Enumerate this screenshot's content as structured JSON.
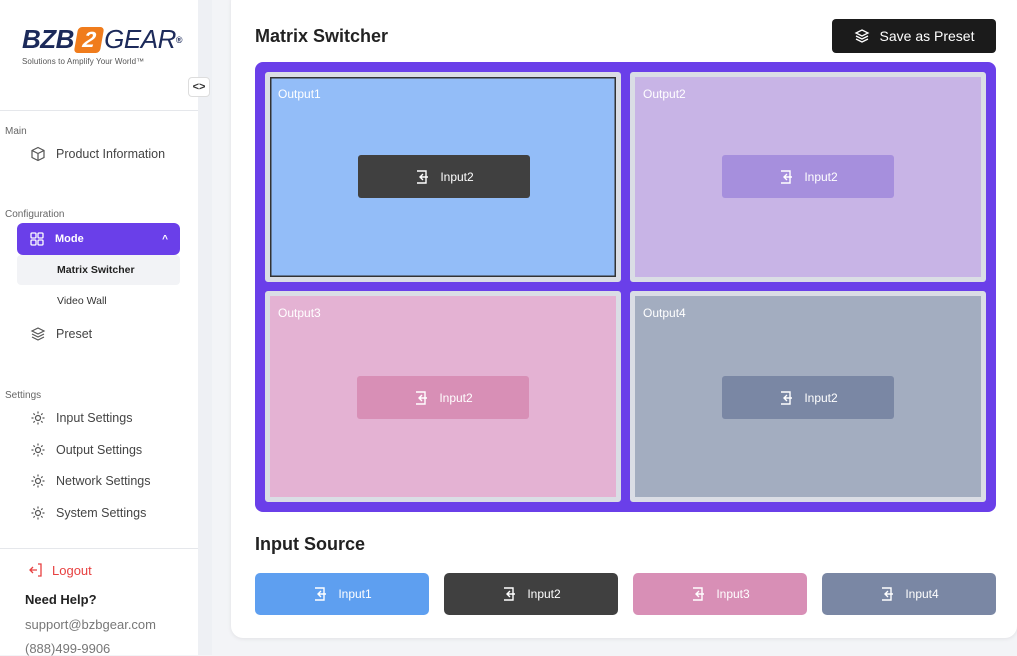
{
  "brand": {
    "bzb": "BZB",
    "two": "2",
    "gear": "GEAR",
    "reg": "®",
    "tagline": "Solutions to Amplify Your World™"
  },
  "sidebar": {
    "toggle_label": "<>",
    "main_section": "Main",
    "product_info": "Product Information",
    "config_section": "Configuration",
    "mode_label": "Mode",
    "mode_chevron": "^",
    "sub_matrix": "Matrix Switcher",
    "sub_videowall": "Video Wall",
    "preset_label": "Preset",
    "settings_section": "Settings",
    "settings_items": [
      "Input Settings",
      "Output Settings",
      "Network Settings",
      "System Settings"
    ],
    "logout": "Logout",
    "help_title": "Need Help?",
    "support_email": "support@bzbgear.com",
    "phone": "(888)499-9906"
  },
  "header": {
    "title": "Matrix Switcher",
    "preset_button": "Save as Preset"
  },
  "matrix": {
    "outputs": [
      {
        "label": "Output1",
        "input": "Input2",
        "tile_color": "#93bdf8",
        "button_color": "#404040",
        "selected": true
      },
      {
        "label": "Output2",
        "input": "Input2",
        "tile_color": "#c8b4e6",
        "button_color": "#a68fdd",
        "selected": false
      },
      {
        "label": "Output3",
        "input": "Input2",
        "tile_color": "#e4b2d3",
        "button_color": "#d88fb6",
        "selected": false
      },
      {
        "label": "Output4",
        "input": "Input2",
        "tile_color": "#a3adc0",
        "button_color": "#7a87a4",
        "selected": false
      }
    ],
    "accent": "#6a3fe9"
  },
  "input_source": {
    "title": "Input Source",
    "inputs": [
      {
        "label": "Input1",
        "color": "#5e9ff0"
      },
      {
        "label": "Input2",
        "color": "#404040"
      },
      {
        "label": "Input3",
        "color": "#d88fb6"
      },
      {
        "label": "Input4",
        "color": "#7a87a4"
      }
    ]
  },
  "icons": [
    "cube-icon",
    "grid-icon",
    "layers-icon",
    "gear-icon",
    "input-icon",
    "logout-icon"
  ]
}
